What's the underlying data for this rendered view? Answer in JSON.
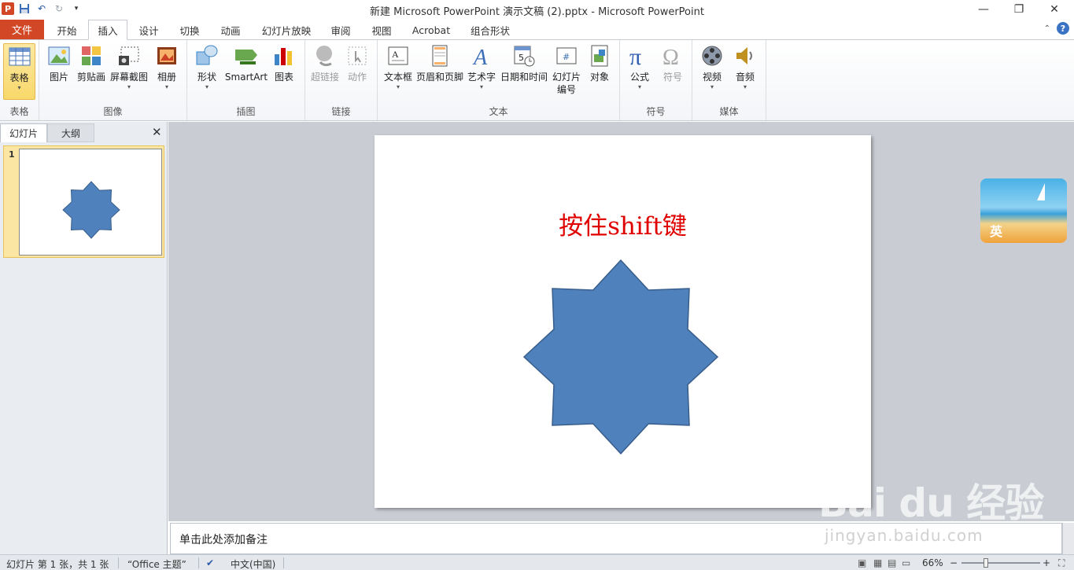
{
  "window": {
    "title": "新建 Microsoft PowerPoint 演示文稿 (2).pptx  -  Microsoft PowerPoint",
    "minimize": "—",
    "maximize": "❐",
    "close": "✕"
  },
  "tabs": {
    "file": "文件",
    "items": [
      "开始",
      "插入",
      "设计",
      "切换",
      "动画",
      "幻灯片放映",
      "审阅",
      "视图",
      "Acrobat",
      "组合形状"
    ],
    "active_index": 1
  },
  "ribbon": {
    "groups": [
      {
        "label": "表格",
        "buttons": [
          {
            "label": "表格",
            "icon": "table-icon",
            "selected": true
          }
        ]
      },
      {
        "label": "图像",
        "buttons": [
          {
            "label": "图片",
            "icon": "picture-icon"
          },
          {
            "label": "剪贴画",
            "icon": "clipart-icon"
          },
          {
            "label": "屏幕截图",
            "icon": "screenshot-icon"
          },
          {
            "label": "相册",
            "icon": "photo-album-icon"
          }
        ]
      },
      {
        "label": "插图",
        "buttons": [
          {
            "label": "形状",
            "icon": "shapes-icon"
          },
          {
            "label": "SmartArt",
            "icon": "smartart-icon"
          },
          {
            "label": "图表",
            "icon": "chart-icon"
          }
        ]
      },
      {
        "label": "链接",
        "buttons": [
          {
            "label": "超链接",
            "icon": "hyperlink-icon",
            "disabled": true
          },
          {
            "label": "动作",
            "icon": "action-icon",
            "disabled": true
          }
        ]
      },
      {
        "label": "文本",
        "buttons": [
          {
            "label": "文本框",
            "icon": "textbox-icon"
          },
          {
            "label": "页眉和页脚",
            "icon": "header-footer-icon"
          },
          {
            "label": "艺术字",
            "icon": "wordart-icon"
          },
          {
            "label": "日期和时间",
            "icon": "date-time-icon"
          },
          {
            "label": "幻灯片\n编号",
            "icon": "slide-number-icon"
          },
          {
            "label": "对象",
            "icon": "object-icon"
          }
        ]
      },
      {
        "label": "符号",
        "buttons": [
          {
            "label": "公式",
            "icon": "equation-icon"
          },
          {
            "label": "符号",
            "icon": "symbol-icon",
            "disabled": true
          }
        ]
      },
      {
        "label": "媒体",
        "buttons": [
          {
            "label": "视频",
            "icon": "video-icon"
          },
          {
            "label": "音频",
            "icon": "audio-icon"
          }
        ]
      }
    ]
  },
  "left_panel": {
    "tabs": [
      "幻灯片",
      "大纲"
    ],
    "close": "✕",
    "slides": [
      {
        "number": "1"
      }
    ]
  },
  "slide": {
    "title": "按住shift键",
    "shape_color": "#4f81bd",
    "shape_stroke": "#385d8a"
  },
  "ime": {
    "text": "英"
  },
  "notes": {
    "placeholder": "单击此处添加备注"
  },
  "statusbar": {
    "slide_info": "幻灯片 第 1 张，共 1 张",
    "theme": "“Office 主题”",
    "language": "中文(中国)",
    "zoom": "66%",
    "zoom_minus": "−",
    "zoom_plus": "+"
  },
  "watermark": {
    "brand": "Bai  du 经验",
    "url": "jingyan.baidu.com"
  }
}
